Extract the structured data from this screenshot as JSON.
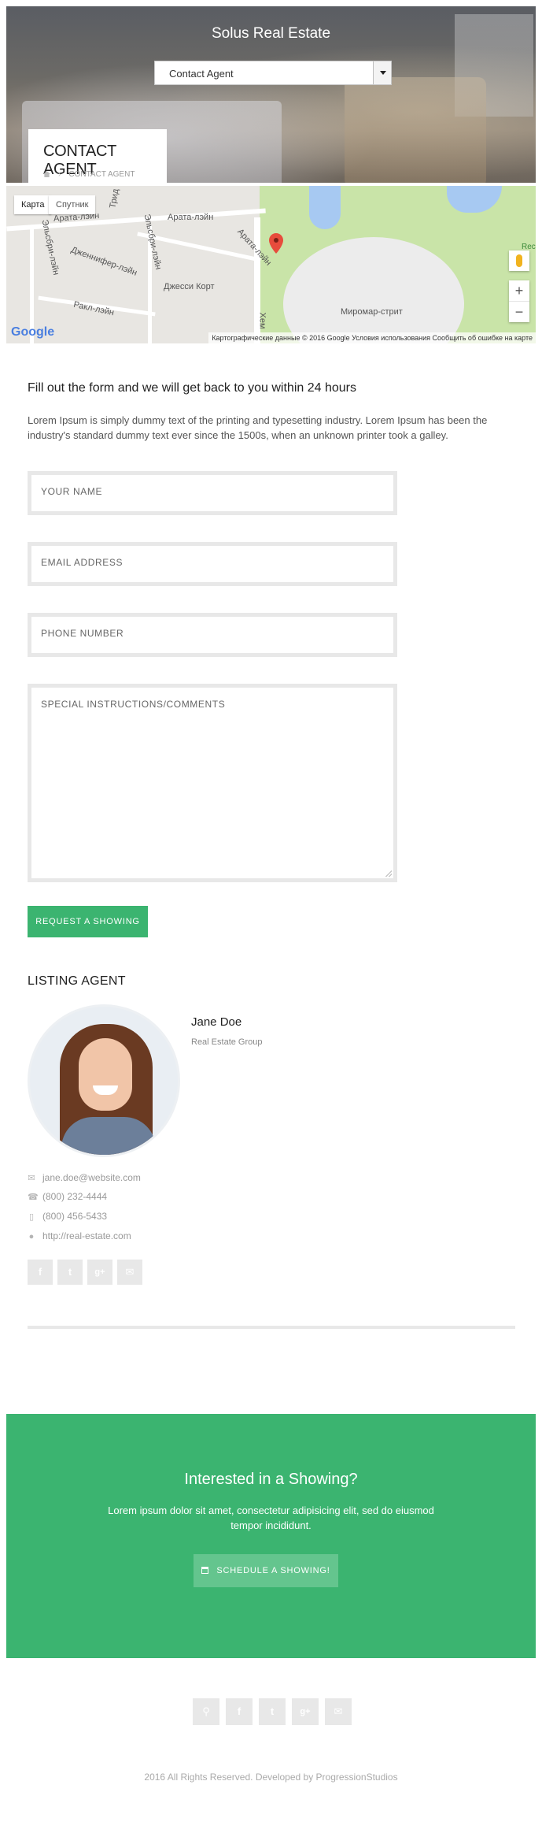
{
  "header": {
    "site_title": "Solus Real Estate",
    "nav_select_value": "Contact Agent",
    "page_title": "CONTACT AGENT",
    "breadcrumb_current": "CONTACT AGENT"
  },
  "map": {
    "tab_map": "Карта",
    "tab_satellite": "Спутник",
    "labels": [
      "Арата-лэйн",
      "Арата-лэйн",
      "Арата-лэйн",
      "Эльсбри-лэйн",
      "Дженнифер-лэйн",
      "Эльсбри-лэйн",
      "Джесси Корт",
      "Ракл-лэйн",
      "Миромар-стрит",
      "Трид",
      "Хем",
      "Rec"
    ],
    "zoom_in": "+",
    "zoom_out": "−",
    "logo": "Google",
    "attribution": "Картографические данные © 2016 Google     Условия использования     Сообщить об ошибке на карте"
  },
  "form": {
    "heading": "Fill out the form and we will get back to you within 24 hours",
    "intro": "Lorem Ipsum is simply dummy text of the printing and typesetting industry. Lorem Ipsum has been the industry's standard dummy text ever since the 1500s, when an unknown printer took a galley.",
    "name_placeholder": "YOUR NAME",
    "email_placeholder": "EMAIL ADDRESS",
    "phone_placeholder": "PHONE NUMBER",
    "comments_placeholder": "SPECIAL INSTRUCTIONS/COMMENTS",
    "submit_label": "REQUEST A SHOWING"
  },
  "agent": {
    "section_title": "LISTING AGENT",
    "name": "Jane Doe",
    "company": "Real Estate Group",
    "email": "jane.doe@website.com",
    "phone": "(800) 232-4444",
    "mobile": "(800) 456-5433",
    "website": "http://real-estate.com",
    "social": [
      "f",
      "t",
      "g+",
      "✉"
    ]
  },
  "cta": {
    "title": "Interested in a Showing?",
    "text": "Lorem ipsum dolor sit amet, consectetur adipisicing elit, sed do eiusmod tempor incididunt.",
    "button_label": "SCHEDULE A SHOWING!"
  },
  "footer": {
    "social": [
      "⚲",
      "f",
      "t",
      "g+",
      "✉"
    ],
    "copyright": "2016 All Rights Reserved. Developed by ProgressionStudios"
  },
  "colors": {
    "accent": "#3bb470",
    "field_border": "#e8e8e8"
  }
}
